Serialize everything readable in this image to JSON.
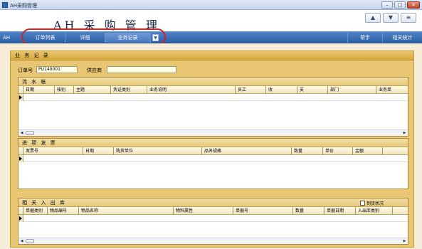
{
  "window": {
    "title": "AH采购管理",
    "min": "–",
    "max": "□",
    "close": "✕"
  },
  "header": {
    "brand": "AH 采 购 管 理"
  },
  "toolbar": {
    "icons": [
      "up-arrow-icon",
      "down-arrow-icon",
      "menu-icon"
    ],
    "btn1": "▲",
    "btn2": "▼",
    "btn3": "≡"
  },
  "nav": {
    "ah": "AH",
    "items": [
      {
        "label": "订单列表"
      },
      {
        "label": "详细"
      },
      {
        "label": "业务记录"
      }
    ],
    "more": "▼",
    "right": [
      {
        "label": "帮手"
      },
      {
        "label": "相关统计"
      }
    ]
  },
  "panel": {
    "title": "业 务 记 录"
  },
  "form": {
    "order_label": "订单号",
    "order_value": "PU140001",
    "supplier_label": "供应商",
    "supplier_value": ""
  },
  "sections": {
    "flow": {
      "title": "流 水 帐",
      "columns": [
        "日期",
        "帐别",
        "主题",
        "凭证类别",
        "业务说明",
        "员工",
        "收",
        "支",
        "部门",
        "业务单"
      ]
    },
    "invoice": {
      "title": "进 项 发 票",
      "columns": [
        "发票号",
        "日期",
        "购货单位",
        "品名规格",
        "数量",
        "单价",
        "金额"
      ]
    },
    "stock": {
      "title": "相 关 入 出 库",
      "checkbox_label": "到货状况",
      "columns": [
        "单据类别",
        "物品编号",
        "物品名称",
        "物料属性",
        "单据号",
        "数量",
        "单据日期",
        "入出库类别"
      ]
    }
  },
  "scroll": {
    "left": "◀",
    "right": "▶"
  }
}
